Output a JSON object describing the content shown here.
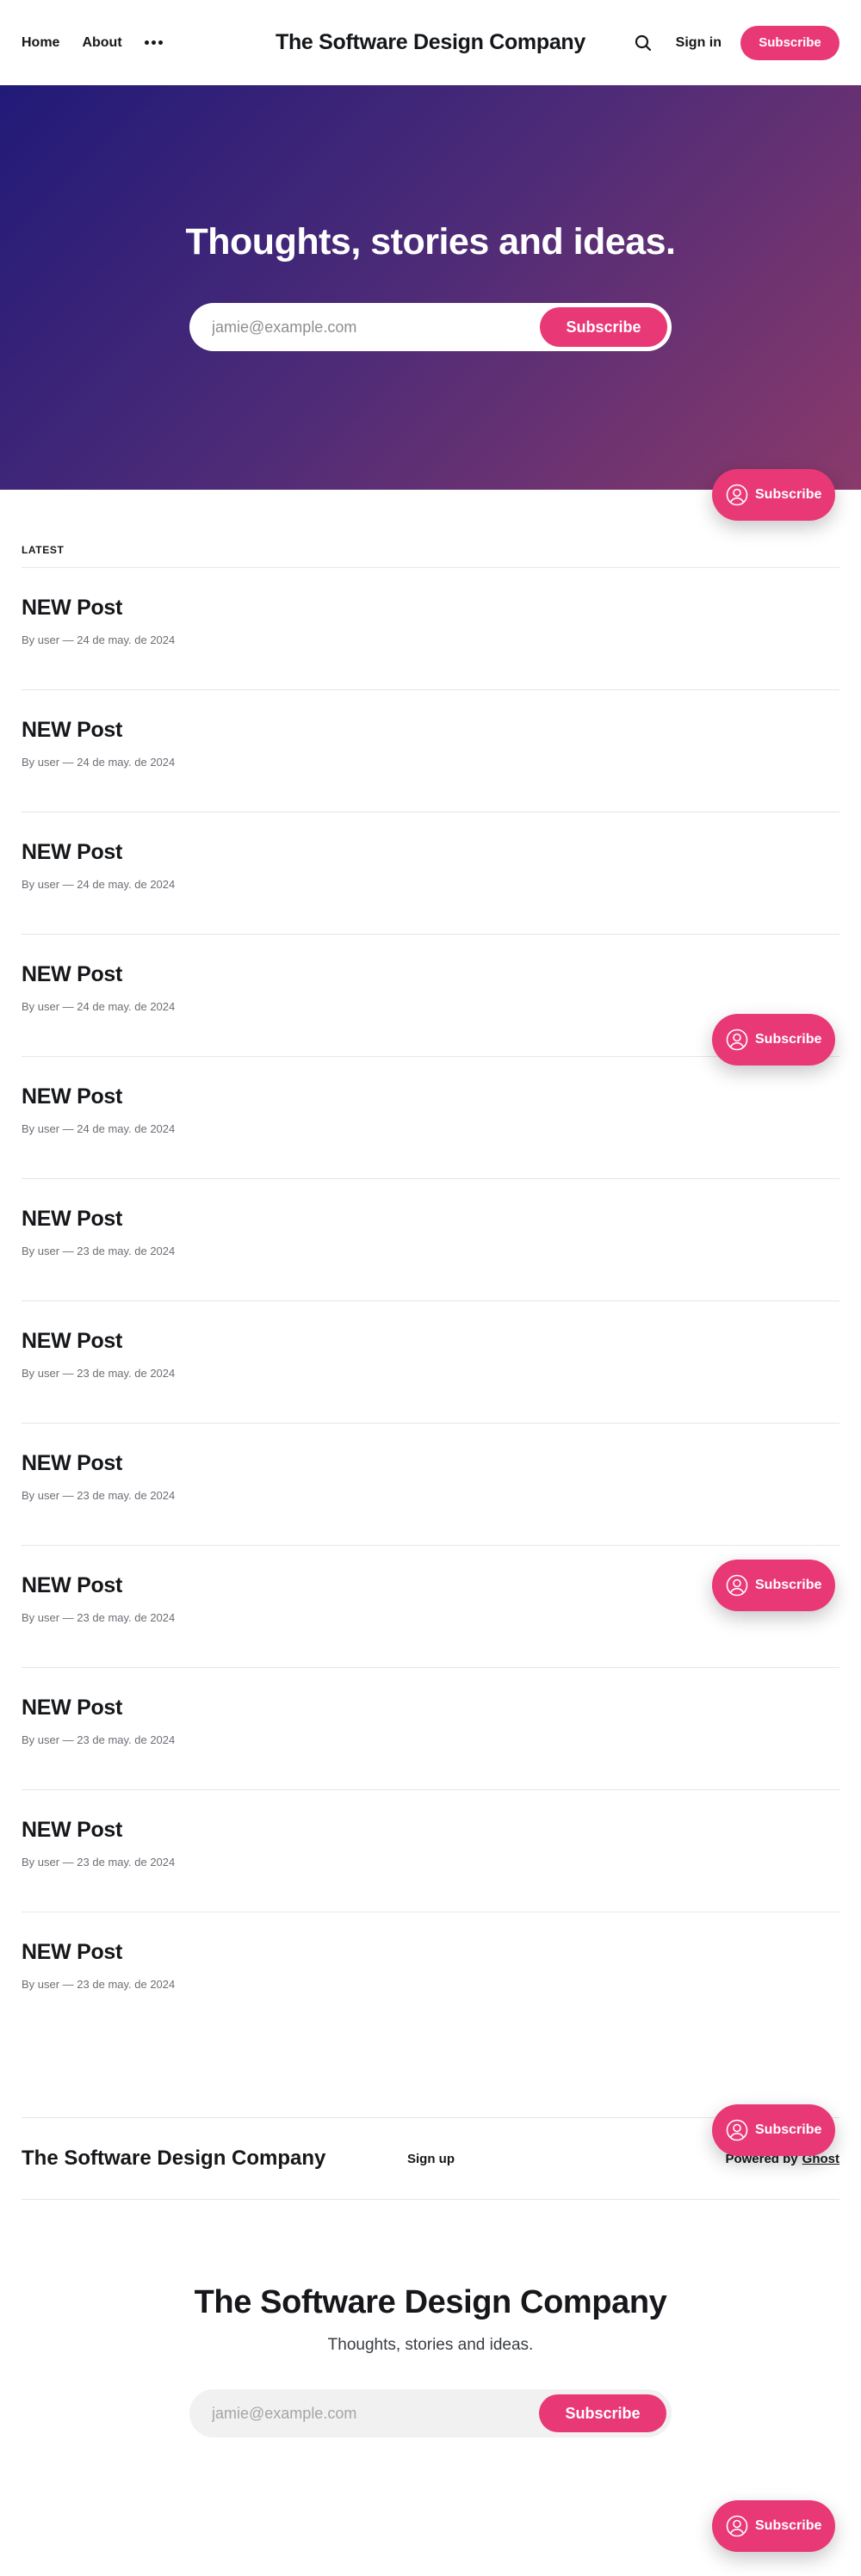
{
  "header": {
    "nav": [
      "Home",
      "About"
    ],
    "site_title": "The Software Design Company",
    "signin_label": "Sign in",
    "subscribe_label": "Subscribe"
  },
  "hero": {
    "title": "Thoughts, stories and ideas.",
    "email_placeholder": "jamie@example.com",
    "subscribe_label": "Subscribe"
  },
  "feed": {
    "label": "LATEST",
    "posts": [
      {
        "title": "NEW Post",
        "meta": "By user — 24 de may. de 2024"
      },
      {
        "title": "NEW Post",
        "meta": "By user — 24 de may. de 2024"
      },
      {
        "title": "NEW Post",
        "meta": "By user — 24 de may. de 2024"
      },
      {
        "title": "NEW Post",
        "meta": "By user — 24 de may. de 2024"
      },
      {
        "title": "NEW Post",
        "meta": "By user — 24 de may. de 2024"
      },
      {
        "title": "NEW Post",
        "meta": "By user — 23 de may. de 2024"
      },
      {
        "title": "NEW Post",
        "meta": "By user — 23 de may. de 2024"
      },
      {
        "title": "NEW Post",
        "meta": "By user — 23 de may. de 2024"
      },
      {
        "title": "NEW Post",
        "meta": "By user — 23 de may. de 2024"
      },
      {
        "title": "NEW Post",
        "meta": "By user — 23 de may. de 2024"
      },
      {
        "title": "NEW Post",
        "meta": "By user — 23 de may. de 2024"
      },
      {
        "title": "NEW Post",
        "meta": "By user — 23 de may. de 2024"
      }
    ]
  },
  "footer": {
    "site_title": "The Software Design Company",
    "signup_label": "Sign up",
    "powered_by": "Powered by",
    "powered_link": "Ghost"
  },
  "cta": {
    "title": "The Software Design Company",
    "description": "Thoughts, stories and ideas.",
    "email_placeholder": "jamie@example.com",
    "subscribe_label": "Subscribe"
  },
  "portal": {
    "label": "Subscribe",
    "icon": "user-circle-icon"
  },
  "colors": {
    "accent": "#e93876",
    "text": "#15171a",
    "hero_gradient_start": "#211a78",
    "hero_gradient_end": "#8a3a6b"
  }
}
